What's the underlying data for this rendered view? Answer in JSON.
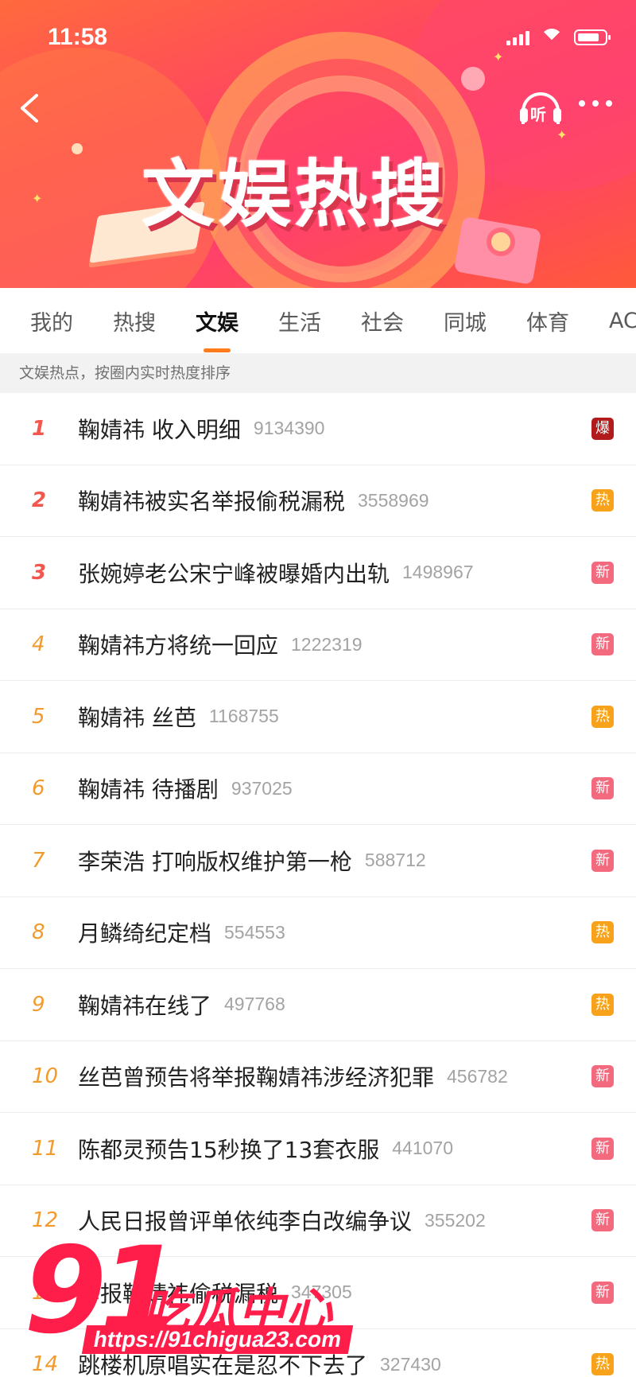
{
  "status_bar": {
    "time": "11:58"
  },
  "header": {
    "title": "文娱热搜",
    "listen_label": "听"
  },
  "tabs": [
    {
      "label": "我的"
    },
    {
      "label": "热搜"
    },
    {
      "label": "文娱",
      "active": true
    },
    {
      "label": "生活"
    },
    {
      "label": "社会"
    },
    {
      "label": "同城"
    },
    {
      "label": "体育"
    },
    {
      "label": "AC"
    }
  ],
  "hint": "文娱热点，按圈内实时热度排序",
  "list": [
    {
      "rank": "1",
      "title": "鞠婧祎 收入明细",
      "heat": "9134390",
      "badge": "爆",
      "badge_type": "bao"
    },
    {
      "rank": "2",
      "title": "鞠婧祎被实名举报偷税漏税",
      "heat": "3558969",
      "badge": "热",
      "badge_type": "re"
    },
    {
      "rank": "3",
      "title": "张婉婷老公宋宁峰被曝婚内出轨",
      "heat": "1498967",
      "badge": "新",
      "badge_type": "xin"
    },
    {
      "rank": "4",
      "title": "鞠婧祎方将统一回应",
      "heat": "1222319",
      "badge": "新",
      "badge_type": "xin"
    },
    {
      "rank": "5",
      "title": "鞠婧祎 丝芭",
      "heat": "1168755",
      "badge": "热",
      "badge_type": "re"
    },
    {
      "rank": "6",
      "title": "鞠婧祎 待播剧",
      "heat": "937025",
      "badge": "新",
      "badge_type": "xin"
    },
    {
      "rank": "7",
      "title": "李荣浩 打响版权维护第一枪",
      "heat": "588712",
      "badge": "新",
      "badge_type": "xin"
    },
    {
      "rank": "8",
      "title": "月鳞绮纪定档",
      "heat": "554553",
      "badge": "热",
      "badge_type": "re"
    },
    {
      "rank": "9",
      "title": "鞠婧祎在线了",
      "heat": "497768",
      "badge": "热",
      "badge_type": "re"
    },
    {
      "rank": "10",
      "title": "丝芭曾预告将举报鞠婧祎涉经济犯罪",
      "heat": "456782",
      "badge": "新",
      "badge_type": "xin"
    },
    {
      "rank": "11",
      "title": "陈都灵预告15秒换了13套衣服",
      "heat": "441070",
      "badge": "新",
      "badge_type": "xin"
    },
    {
      "rank": "12",
      "title": "人民日报曾评单依纯李白改编争议",
      "heat": "355202",
      "badge": "新",
      "badge_type": "xin"
    },
    {
      "rank": "13",
      "title": "举报鞠婧祎偷税漏税",
      "heat": "347305",
      "badge": "新",
      "badge_type": "xin"
    },
    {
      "rank": "14",
      "title": "跳楼机原唱实在是忍不下去了",
      "heat": "327430",
      "badge": "热",
      "badge_type": "re"
    }
  ],
  "watermark": {
    "number": "91",
    "brand": "吃瓜中心",
    "url": "https://91chigua23.com"
  },
  "colors": {
    "accent": "#ff7a18",
    "rank_top": "#f2574e",
    "rank_rest": "#f39a2c",
    "badge_bao": "#b21b1b",
    "badge_re": "#f7a21a",
    "badge_xin": "#f36a7f"
  }
}
